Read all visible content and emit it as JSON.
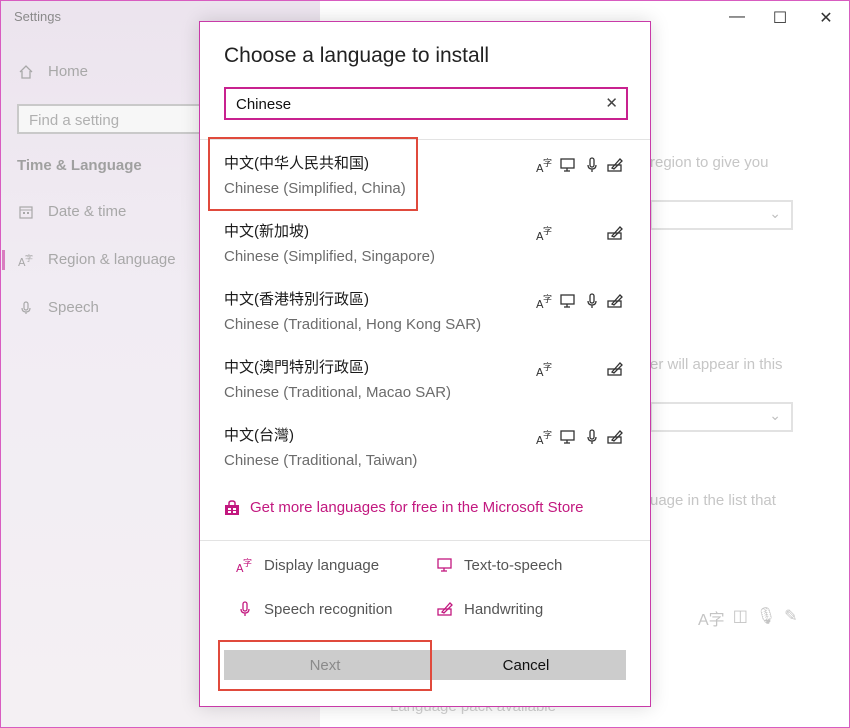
{
  "app": {
    "title": "Settings"
  },
  "left_nav": {
    "home": "Home",
    "search_placeholder": "Find a setting",
    "section": "Time & Language",
    "items": [
      {
        "label": "Date & time",
        "icon": "calendar-icon"
      },
      {
        "label": "Region & language",
        "icon": "language-icon",
        "active": true
      },
      {
        "label": "Speech",
        "icon": "microphone-icon"
      }
    ]
  },
  "window_controls": {
    "minimize": "—",
    "maximize": "☐",
    "close": "✕"
  },
  "background_page": {
    "text1": "region to give you",
    "text2": "er will appear in this",
    "text3": "uage in the list that",
    "footer": "Language pack available"
  },
  "dialog": {
    "title": "Choose a language to install",
    "search_value": "Chinese",
    "clear_icon": "✕",
    "languages": [
      {
        "native": "中文(中华人民共和国)",
        "english": "Chinese (Simplified, China)",
        "features": [
          "display",
          "tts",
          "speech",
          "handwriting"
        ]
      },
      {
        "native": "中文(新加坡)",
        "english": "Chinese (Simplified, Singapore)",
        "features": [
          "display",
          "handwriting"
        ]
      },
      {
        "native": "中文(香港特別行政區)",
        "english": "Chinese (Traditional, Hong Kong SAR)",
        "features": [
          "display",
          "tts",
          "speech",
          "handwriting"
        ]
      },
      {
        "native": "中文(澳門特別行政區)",
        "english": "Chinese (Traditional, Macao SAR)",
        "features": [
          "display",
          "handwriting"
        ]
      },
      {
        "native": "中文(台灣)",
        "english": "Chinese (Traditional, Taiwan)",
        "features": [
          "display",
          "tts",
          "speech",
          "handwriting"
        ]
      }
    ],
    "store_link": "Get more languages for free in the Microsoft Store",
    "legend": {
      "display": "Display language",
      "tts": "Text-to-speech",
      "speech": "Speech recognition",
      "handwriting": "Handwriting"
    },
    "buttons": {
      "next": "Next",
      "cancel": "Cancel"
    }
  },
  "colors": {
    "accent": "#c2187f",
    "highlight": "#e04a3c",
    "button": "#cccccc"
  }
}
